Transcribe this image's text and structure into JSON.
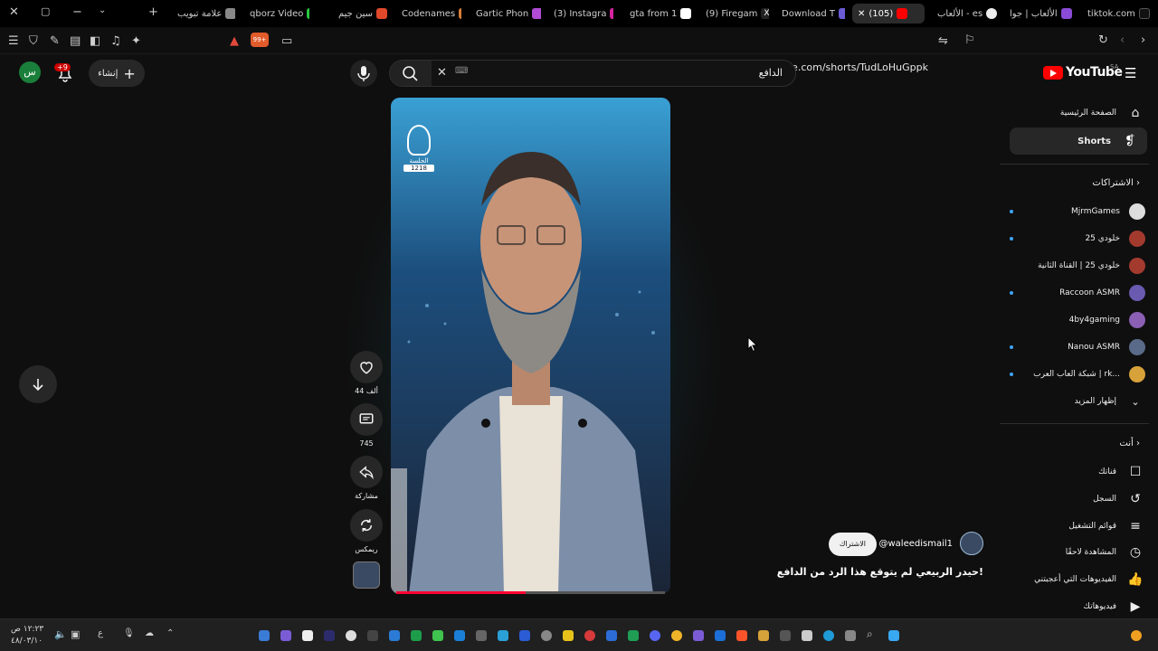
{
  "browser": {
    "tabs": [
      {
        "title": "tiktok.com"
      },
      {
        "title": "الألعاب | جوا"
      },
      {
        "title": "الألعاب - es"
      },
      {
        "title": "(105)"
      },
      {
        "title": "Download T"
      },
      {
        "title": "(9) Firegam"
      },
      {
        "title": "gta from 1"
      },
      {
        "title": "(3) Instagra"
      },
      {
        "title": "Gartic Phon"
      },
      {
        "title": "Codenames"
      },
      {
        "title": "سين جيم"
      },
      {
        "title": "qborz Video"
      },
      {
        "title": "علامة تبويب"
      }
    ],
    "url": "youtube.com/shorts/TudLoHuGppk",
    "shield_count": "99+"
  },
  "header": {
    "logo_text": "YouTube",
    "country": "SA",
    "search_value": "الدافع",
    "create_label": "إنشاء",
    "notif_badge": "+9",
    "avatar_letter": "س"
  },
  "sidebar": {
    "main": [
      {
        "label": "الصفحة الرئيسية",
        "icon": "home-icon"
      },
      {
        "label": "Shorts",
        "icon": "shorts-icon"
      }
    ],
    "subs_heading": "الاشتراكات",
    "subscriptions": [
      {
        "label": "MjrmGames",
        "dot": true,
        "color": "#dddddd"
      },
      {
        "label": "خلودي 25",
        "dot": true,
        "color": "#a33a2e"
      },
      {
        "label": "خلودي 25 | القناة الثانية",
        "dot": false,
        "color": "#a33a2e"
      },
      {
        "label": "Raccoon ASMR",
        "dot": true,
        "color": "#6a5ab0"
      },
      {
        "label": "4by4gaming",
        "dot": false,
        "color": "#8a5fb4"
      },
      {
        "label": "Nanou ASMR",
        "dot": true,
        "color": "#5a6b8a"
      },
      {
        "label": "شبكة العاب العرب | rk...",
        "dot": true,
        "color": "#d8a23a"
      }
    ],
    "show_more": "إظهار المزيد",
    "you_heading": "أنت",
    "you": [
      {
        "label": "قناتك",
        "icon": "channel-icon"
      },
      {
        "label": "السجل",
        "icon": "history-icon"
      },
      {
        "label": "قوائم التشغيل",
        "icon": "playlist-icon"
      },
      {
        "label": "المشاهدة لاحقًا",
        "icon": "clock-icon"
      },
      {
        "label": "الفيديوهات التي أعجبتني",
        "icon": "like-icon"
      },
      {
        "label": "فيديوهاتك",
        "icon": "video-icon"
      }
    ]
  },
  "short": {
    "watermark_text": "الجلسة",
    "watermark_number": "1218",
    "likes": "44 ألف",
    "comments": "745",
    "share_label": "مشاركة",
    "remix_label": "ريمكس",
    "channel_handle": "@waleedismail1",
    "subscribe_label": "الاشتراك",
    "title": "حيدر الربيعي لم يتوقع هذا الرد من الدافع!",
    "progress": 0.48
  },
  "taskbar": {
    "time": "١٢:٢٣ ص",
    "date": "٤٨/٠٣/١٠",
    "lang": "ع"
  }
}
